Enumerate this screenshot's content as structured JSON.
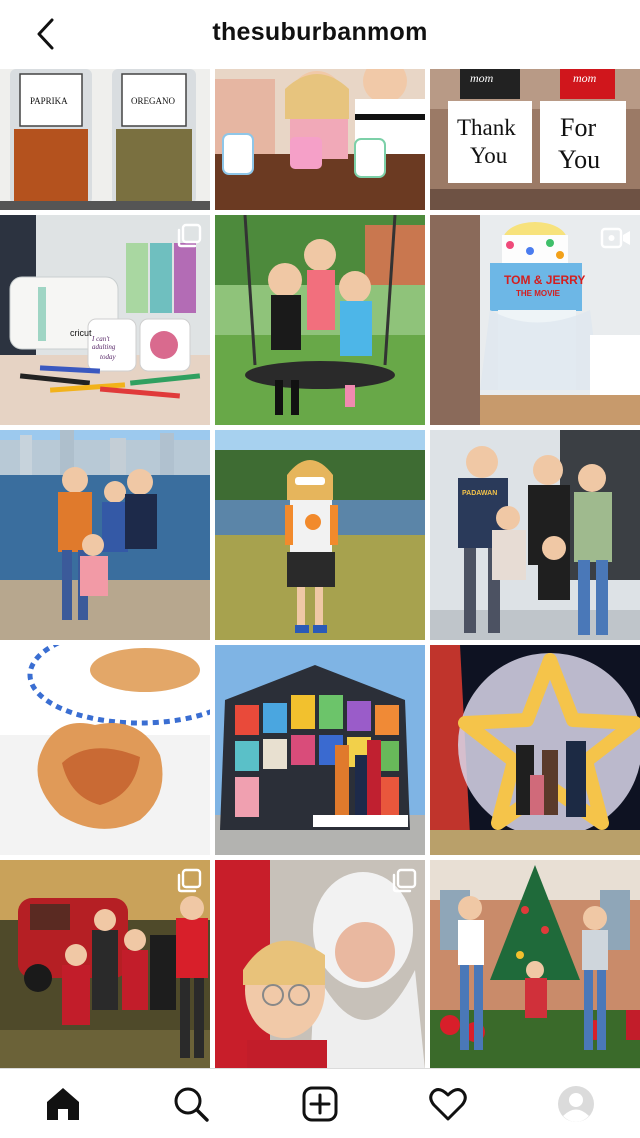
{
  "header": {
    "title": "thesuburbanmom",
    "back_icon": "chevron-left-icon"
  },
  "grid": {
    "tiles": [
      {
        "name": "post-spice-jars",
        "labels": [
          "PAPRIKA",
          "OREGANO"
        ]
      },
      {
        "name": "post-girls-with-cake-toys"
      },
      {
        "name": "post-thank-you-mugs",
        "labels": [
          "Thank",
          "You",
          "For",
          "You",
          "mom",
          "mom"
        ]
      },
      {
        "name": "post-cricut-mug-press",
        "labels": [
          "cricut",
          "I can't adulting",
          "today"
        ],
        "badge": "multi-photo-icon"
      },
      {
        "name": "post-girls-on-swing"
      },
      {
        "name": "post-tom-and-jerry-cake",
        "labels": [
          "TOM & JERRY",
          "THE MOVIE"
        ],
        "badge": "video-icon"
      },
      {
        "name": "post-family-by-lake"
      },
      {
        "name": "post-girl-in-sunglasses"
      },
      {
        "name": "post-family-star-wars-shirts",
        "labels": [
          "PADAWAN"
        ]
      },
      {
        "name": "post-pastry-cups"
      },
      {
        "name": "post-stained-glass-house"
      },
      {
        "name": "post-star-light-display"
      },
      {
        "name": "post-family-red-truck",
        "badge": "multi-photo-icon"
      },
      {
        "name": "post-santa-photo",
        "badge": "multi-photo-icon"
      },
      {
        "name": "post-christmas-tree-garden"
      }
    ]
  },
  "tabbar": {
    "items": [
      "home-icon",
      "search-icon",
      "add-post-icon",
      "activity-heart-icon",
      "profile-avatar-icon"
    ]
  },
  "colors": {
    "text": "#111111",
    "divider": "#dbdbdb",
    "background": "#ffffff"
  }
}
